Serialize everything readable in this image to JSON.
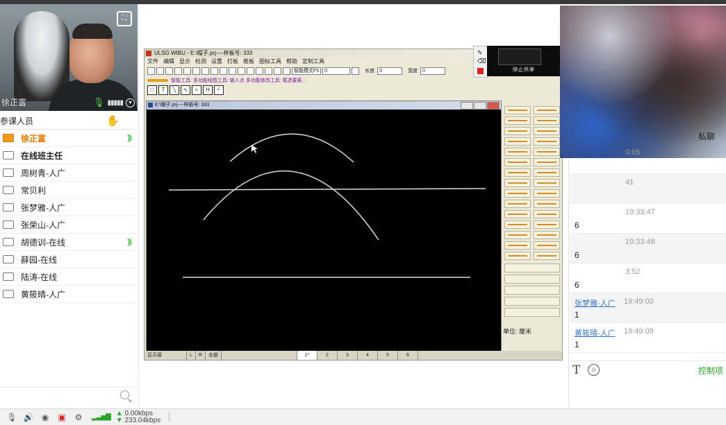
{
  "webcam": {
    "presenter_name": "徐正富"
  },
  "participants": {
    "header": "参课人员",
    "items": [
      {
        "name": "徐正富",
        "role": "host",
        "speaking": true
      },
      {
        "name": "在线班主任",
        "role": "assistant",
        "speaking": false
      },
      {
        "name": "周树青-人广",
        "role": "member",
        "speaking": false
      },
      {
        "name": "常贝利",
        "role": "member",
        "speaking": false
      },
      {
        "name": "张梦雅-人广",
        "role": "member",
        "speaking": false
      },
      {
        "name": "张荣山-人广",
        "role": "member",
        "speaking": false
      },
      {
        "name": "胡德训-在线",
        "role": "member",
        "speaking": true
      },
      {
        "name": "薛园-在线",
        "role": "member",
        "speaking": false
      },
      {
        "name": "陆涛-在线",
        "role": "member",
        "speaking": false
      },
      {
        "name": "黄筱晴-人广",
        "role": "member",
        "speaking": false
      }
    ]
  },
  "statusbar": {
    "upload_rate": "0.00kbps",
    "download_rate": "233.04kbps"
  },
  "cad": {
    "title": "ULSG WIBU - E:\\帽子.prj----样板号: 333",
    "menu": [
      "文件",
      "编辑",
      "显示",
      "检测",
      "设置",
      "打板",
      "推板",
      "图标工具",
      "帮助",
      "定制工具"
    ],
    "toolbar": {
      "mode": "智能模式F5",
      "value_field": "0",
      "length_label": "长度",
      "length_value": "0",
      "width_label": "宽度",
      "width_value": "0"
    },
    "smart_tool": "智能工具: 多功能绘图工具: 输入点  多功能修改工具: 框选要素...",
    "drawing_title": "E:\\帽子.prj----样板号: 333",
    "unit_label": "单位: 厘米",
    "bottom": {
      "display_layer": "显示层",
      "left": "L",
      "right": "R",
      "all": "全部",
      "tabs": [
        "1*",
        "2",
        "3",
        "4",
        "5",
        "6"
      ]
    }
  },
  "screen_share": {
    "stop_label": "停止共享"
  },
  "chat": {
    "tab_private": "私聊",
    "messages": [
      {
        "name": "",
        "time": "0:05",
        "text": ""
      },
      {
        "name": "",
        "time": "41",
        "text": ""
      },
      {
        "name": "",
        "time": "19:33:47",
        "text": "6"
      },
      {
        "name": "",
        "time": "19:33:48",
        "text": "6"
      },
      {
        "name": "",
        "time": "3:52",
        "text": "6"
      },
      {
        "name": "张梦雅-人广",
        "time": "19:49:00",
        "text": "1"
      },
      {
        "name": "黄筱晴-人广",
        "time": "19:49:09",
        "text": "1"
      }
    ],
    "control_label": "控制项"
  }
}
